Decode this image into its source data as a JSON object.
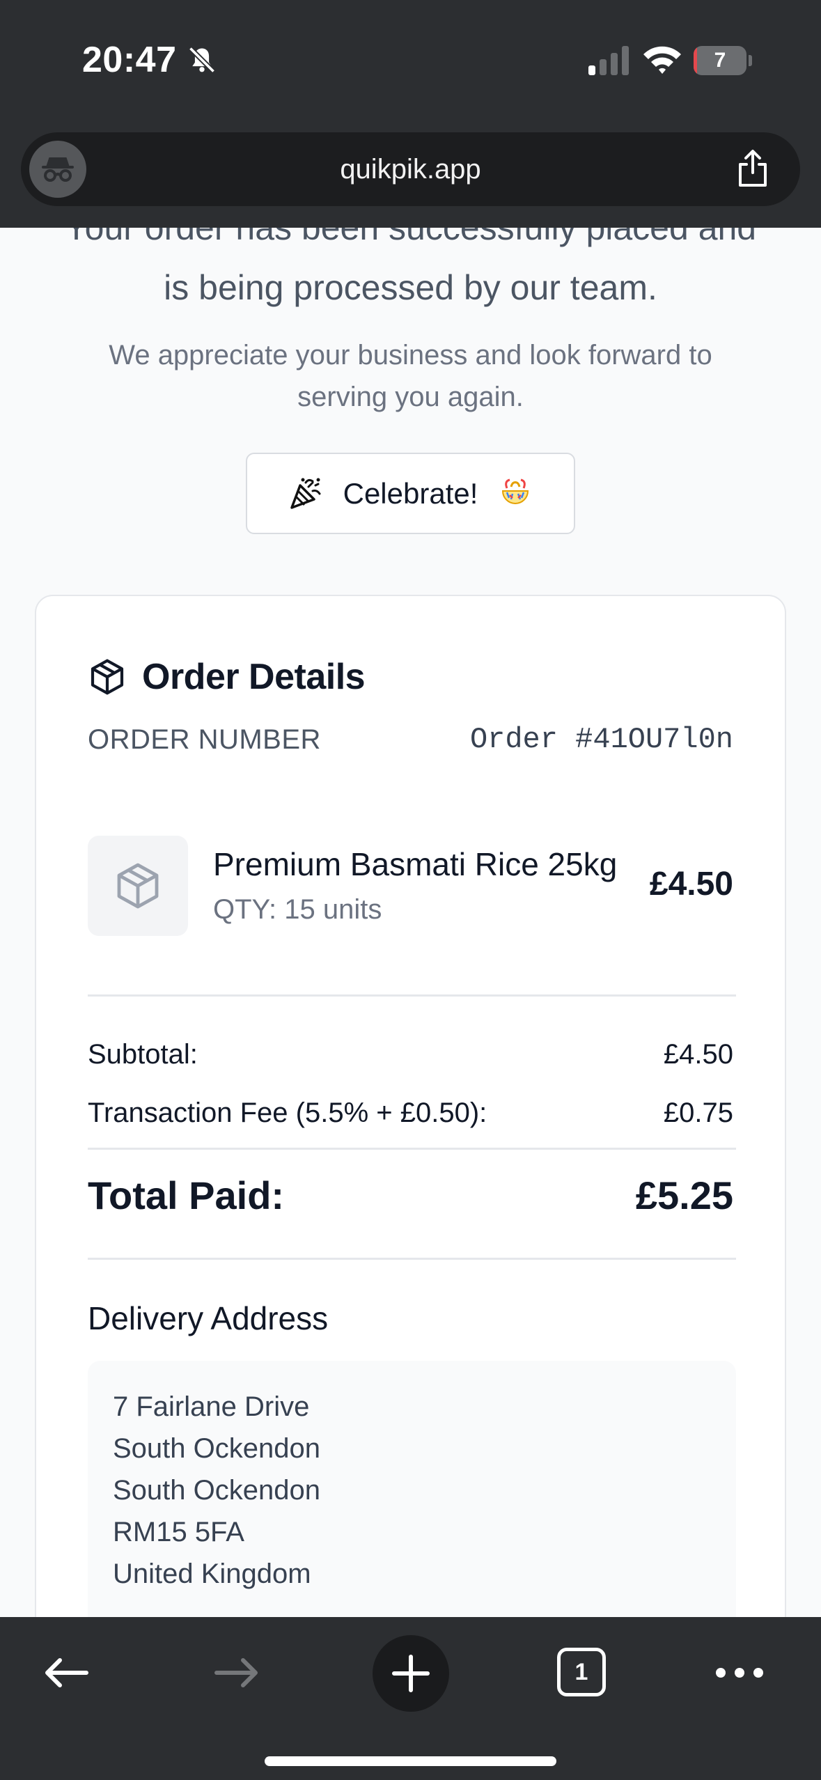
{
  "status_bar": {
    "time": "20:47",
    "battery": "7",
    "battery_level_percent": 7,
    "battery_color": "#e5484d"
  },
  "browser": {
    "url": "quikpik.app",
    "tab_count": "1"
  },
  "confirmation": {
    "message_cut": "Your order has been successfully placed and",
    "message_line2": "is being processed by our team.",
    "sub_message": "We appreciate your business and look forward to serving you again.",
    "celebrate_label": "Celebrate!"
  },
  "order": {
    "title": "Order Details",
    "number_label": "ORDER NUMBER",
    "number_value": "Order #41OU7l0n",
    "item": {
      "name": "Premium Basmati Rice 25kg",
      "qty": "QTY: 15 units",
      "price": "£4.50",
      "thumbnail_icon": "package-icon"
    },
    "subtotal_label": "Subtotal:",
    "subtotal_value": "£4.50",
    "fee_label": "Transaction Fee (5.5% + £0.50):",
    "fee_value": "£0.75",
    "total_label": "Total Paid:",
    "total_value": "£5.25"
  },
  "delivery": {
    "heading": "Delivery Address",
    "lines": [
      "7 Fairlane Drive",
      "South Ockendon",
      "South Ockendon",
      "RM15 5FA",
      "United Kingdom"
    ]
  },
  "colors": {
    "chrome": "#2c2e31",
    "page_bg": "#f9fafb",
    "text_primary": "#111827",
    "text_secondary": "#6b7280"
  }
}
